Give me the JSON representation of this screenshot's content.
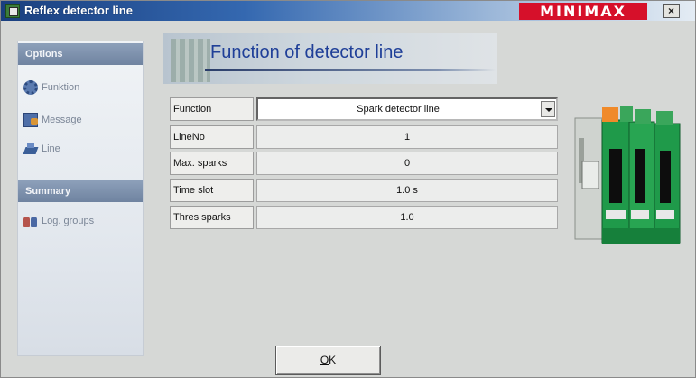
{
  "window": {
    "title": "Reflex detector line",
    "brand_logo": "MINIMAX",
    "close_label": "×"
  },
  "sidebar": {
    "options_header": "Options",
    "options_items": [
      {
        "label": "Funktion",
        "icon": "gear-icon"
      },
      {
        "label": "Message",
        "icon": "message-icon"
      },
      {
        "label": "Line",
        "icon": "line-icon"
      }
    ],
    "summary_header": "Summary",
    "summary_items": [
      {
        "label": "Log. groups",
        "icon": "groups-icon"
      }
    ]
  },
  "main": {
    "page_title": "Function of detector line",
    "fields": [
      {
        "label": "Function",
        "value": "Spark detector line",
        "type": "select"
      },
      {
        "label": "LineNo",
        "value": "1"
      },
      {
        "label": "Max. sparks",
        "value": "0"
      },
      {
        "label": "Time slot",
        "value": "1.0 s"
      },
      {
        "label": "Thres sparks",
        "value": "1.0"
      }
    ]
  },
  "footer": {
    "ok_label_mnemonic": "O",
    "ok_label_rest": "K"
  },
  "colors": {
    "title_accent": "#1f3f98",
    "brand_red": "#d6102a",
    "device_green": "#1f9a4a"
  }
}
